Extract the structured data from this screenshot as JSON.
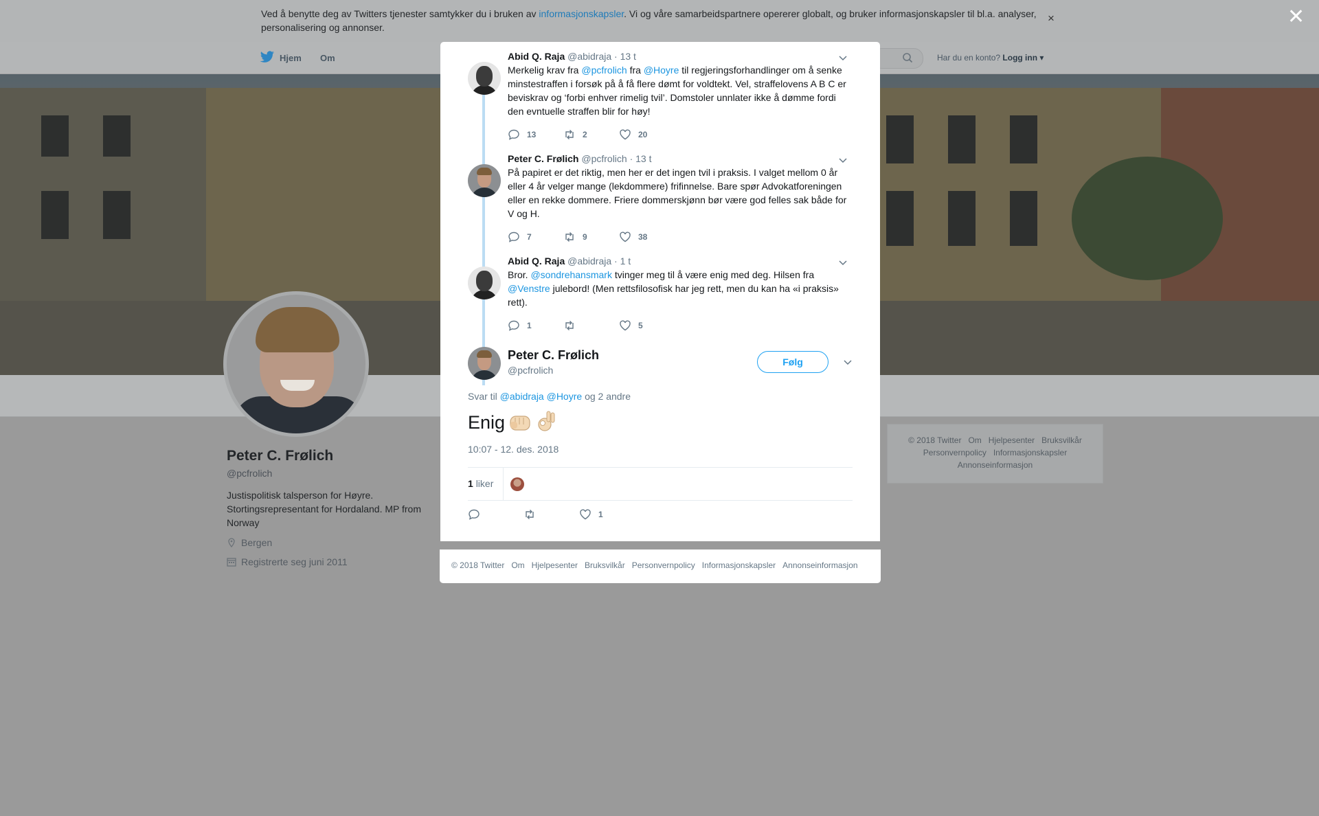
{
  "cookie_banner": {
    "text_before": "Ved å benytte deg av Twitters tjenester samtykker du i bruken av ",
    "link": "informasjonskapsler",
    "text_after": ". Vi og våre samarbeidspartnere opererer globalt, og bruker informasjonskapsler til bl.a. analyser, personalisering og annonser.",
    "close": "×"
  },
  "overlay_close": "✕",
  "nav": {
    "home": "Hjem",
    "about": "Om",
    "account_prompt": "Har du en konto?",
    "login": "Logg inn"
  },
  "profile": {
    "name": "Peter C. Frølich",
    "handle": "@pcfrolich",
    "bio": "Justispolitisk talsperson for Høyre. Stortingsrepresentant for Hordaland. MP from Norway",
    "location": "Bergen",
    "joined": "Registrerte seg juni 2011"
  },
  "side_footer": {
    "line1": [
      "© 2018 Twitter",
      "Om",
      "Hjelpesenter",
      "Bruksvilkår"
    ],
    "line2": [
      "Personvernpolicy",
      "Informasjonskapsler"
    ],
    "line3": [
      "Annonseinformasjon"
    ]
  },
  "thread": [
    {
      "name": "Abid Q. Raja",
      "handle": "@abidraja",
      "time": "· 13 t",
      "text_parts": [
        {
          "t": "Merkelig krav fra "
        },
        {
          "t": "@pcfrolich",
          "link": true
        },
        {
          "t": " fra "
        },
        {
          "t": "@Hoyre",
          "link": true
        },
        {
          "t": " til regjeringsforhandlinger om å senke minstestraffen i forsøk på å få flere dømt for voldtekt. Vel, straffelovens A B C er beviskrav og ‘forbi enhver rimelig tvil’. Domstoler unnlater ikke å dømme fordi den evntuelle straffen blir for høy!"
        }
      ],
      "replies": "13",
      "retweets": "2",
      "likes": "20"
    },
    {
      "name": "Peter C. Frølich",
      "handle": "@pcfrolich",
      "time": "· 13 t",
      "text_parts": [
        {
          "t": "På papiret er det riktig, men her er det ingen tvil i praksis. I valget mellom 0 år eller 4 år velger mange (lekdommere) frifinnelse. Bare spør Advokatforeningen eller en rekke dommere. Friere dommerskjønn bør være god felles sak både for V og H."
        }
      ],
      "replies": "7",
      "retweets": "9",
      "likes": "38"
    },
    {
      "name": "Abid Q. Raja",
      "handle": "@abidraja",
      "time": "· 1 t",
      "text_parts": [
        {
          "t": "Bror. "
        },
        {
          "t": "@sondrehansmark",
          "link": true
        },
        {
          "t": " tvinger meg til å være enig med deg. Hilsen fra "
        },
        {
          "t": "@Venstre",
          "link": true
        },
        {
          "t": " julebord! (Men rettsfilosofisk har jeg rett, men du kan ha «i praksis» rett)."
        }
      ],
      "replies": "1",
      "retweets": "",
      "likes": "5"
    }
  ],
  "main_tweet": {
    "name": "Peter C. Frølich",
    "handle": "@pcfrolich",
    "follow": "Følg",
    "reply_prefix": "Svar til",
    "reply_user1": "@abidraja",
    "reply_user2": "@Hoyre",
    "reply_suffix": "og 2 andre",
    "text": "Enig",
    "timestamp": "10:07 - 12. des. 2018",
    "likes_count": "1",
    "likes_label": "liker",
    "replies": "",
    "retweets": "",
    "likes": "1"
  },
  "modal_footer": [
    "© 2018 Twitter",
    "Om",
    "Hjelpesenter",
    "Bruksvilkår",
    "Personvernpolicy",
    "Informasjonskapsler",
    "Annonseinformasjon"
  ],
  "colors": {
    "link": "#1b95e0",
    "follow": "#1da1f2",
    "thread_line": "#bbdcf3",
    "dim_background": "#9a9a9a"
  }
}
